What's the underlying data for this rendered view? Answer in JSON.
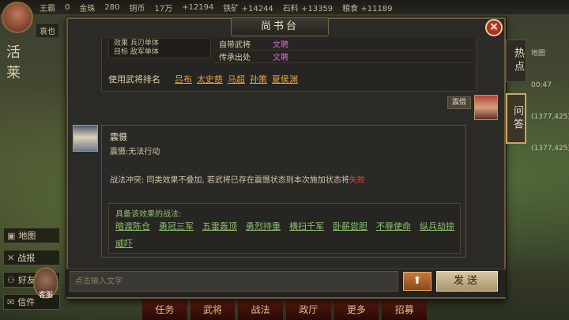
{
  "dialog": {
    "title": "尚书台",
    "close": "×"
  },
  "backdrop": {
    "topbar": [
      "王霸",
      "0",
      "金珠",
      "280",
      "铜币",
      "17万",
      "+12194",
      "铁矿 +14244",
      "石料 +13359",
      "粮食 +11189"
    ],
    "player_tag": "袁也",
    "left_marks": "活 莱",
    "menu": [
      {
        "icon": "▣",
        "label": "地图"
      },
      {
        "icon": "✕",
        "label": "战报"
      },
      {
        "icon": "⚇",
        "label": "好友"
      },
      {
        "icon": "✉",
        "label": "信件"
      }
    ],
    "advisor": "客服",
    "bottom_nav": [
      "任务",
      "武将",
      "战法",
      "政厅",
      "更多",
      "招募"
    ],
    "right_edge": [
      "地图",
      "00:47",
      "(1377,425)",
      "(1377,425)"
    ]
  },
  "info": {
    "left_lines": [
      "效果  兵刃单体",
      "目标  敌军单体"
    ],
    "rows": [
      {
        "key": "自带武将",
        "value": "文聘"
      },
      {
        "key": "传承出处",
        "value": "文聘"
      }
    ],
    "users_label": "使用武将排名",
    "users": [
      "吕布",
      "太史慈",
      "马超",
      "孙策",
      "夏侯渊"
    ]
  },
  "tabs": {
    "hot": "热点",
    "qa": "问答"
  },
  "my_message": {
    "text": "震慑"
  },
  "answer": {
    "name": "震慑",
    "desc": "震慑:无法行动",
    "conflict_text": "战法冲突: 同类效果不叠加, 若武将已存在震慑状态则本次施加状态将",
    "conflict_fail": "失败",
    "tactics_header": "具备该效果的战法:",
    "tactics": [
      "暗渡陈仓",
      "勇冠三军",
      "五雷轰顶",
      "勇烈持重",
      "横扫千军",
      "卧薪尝胆",
      "不辱使命",
      "纵兵劫掠",
      "威吓"
    ]
  },
  "input": {
    "placeholder": "点击输入文字",
    "up": "⬆",
    "send": "发送"
  }
}
